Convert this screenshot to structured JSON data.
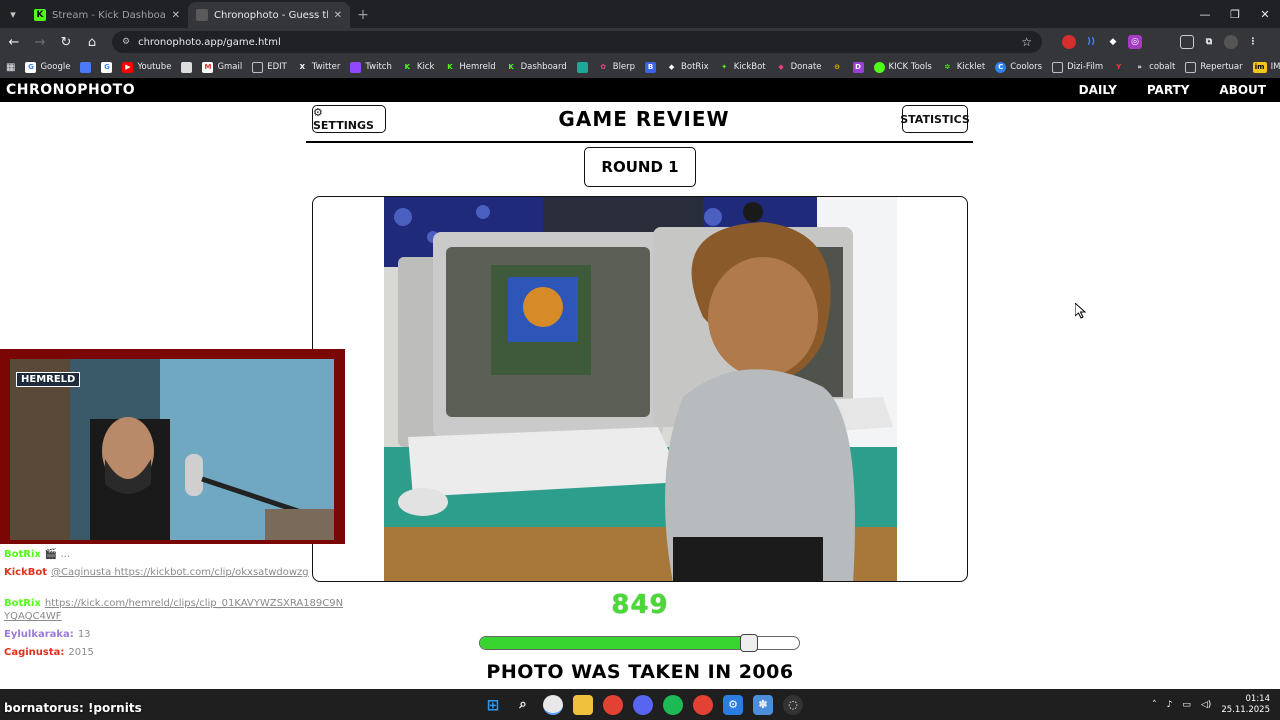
{
  "browser": {
    "tabs": [
      {
        "title": "Stream - Kick Dashboard",
        "icon": "kick-icon",
        "active": false
      },
      {
        "title": "Chronophoto - Guess the Year",
        "icon": "chronophoto-icon",
        "active": true
      }
    ],
    "url": "chronophoto.app/game.html",
    "bookmarks": [
      {
        "label": "Google",
        "icon": "google-icon"
      },
      {
        "label": "",
        "icon": "docs-icon"
      },
      {
        "label": "",
        "icon": "google-icon"
      },
      {
        "label": "Youtube",
        "icon": "youtube-icon"
      },
      {
        "label": "",
        "icon": "image-icon"
      },
      {
        "label": "Gmail",
        "icon": "gmail-icon"
      },
      {
        "label": "EDIT",
        "icon": "folder-icon"
      },
      {
        "label": "Twitter",
        "icon": "x-icon"
      },
      {
        "label": "Twitch",
        "icon": "twitch-icon"
      },
      {
        "label": "Kick",
        "icon": "kick-icon"
      },
      {
        "label": "Hemreld",
        "icon": "kick-icon"
      },
      {
        "label": "Dashboard",
        "icon": "kick-icon"
      },
      {
        "label": "",
        "icon": "chat-icon"
      },
      {
        "label": "Blerp",
        "icon": "blerp-icon"
      },
      {
        "label": "",
        "icon": "shield-icon"
      },
      {
        "label": "BotRix",
        "icon": "botrix-icon"
      },
      {
        "label": "KickBot",
        "icon": "kickbot-icon"
      },
      {
        "label": "Donate",
        "icon": "donate-icon"
      },
      {
        "label": "",
        "icon": "coin-icon"
      },
      {
        "label": "",
        "icon": "badge-icon"
      },
      {
        "label": "KICK Tools",
        "icon": "kicktools-icon"
      },
      {
        "label": "Kicklet",
        "icon": "kicklet-icon"
      },
      {
        "label": "Coolors",
        "icon": "coolors-icon"
      },
      {
        "label": "Dizi-Film",
        "icon": "folder-icon"
      },
      {
        "label": "",
        "icon": "yandex-icon"
      },
      {
        "label": "cobalt",
        "icon": "cobalt-icon"
      },
      {
        "label": "Repertuar",
        "icon": "folder-icon"
      },
      {
        "label": "IMDb",
        "icon": "imdb-icon"
      }
    ]
  },
  "site": {
    "logo": "CHRONOPHOTO",
    "nav": [
      "DAILY",
      "PARTY",
      "ABOUT"
    ]
  },
  "game": {
    "settings_label": "⚙ SETTINGS",
    "title": "GAME REVIEW",
    "statistics_label": "STATISTICS",
    "round_label": "ROUND 1",
    "score": "849",
    "slider_fraction": 0.84,
    "verdict": "PHOTO WAS TAKEN IN 2006"
  },
  "stream": {
    "cam_label": "HEMRELD",
    "chat": [
      {
        "user": "BotRix",
        "user_color": "#53fc18",
        "text": "🎬 ..."
      },
      {
        "user": "KickBot",
        "user_color": "#e0301e",
        "text": "@Caginusta https://kickbot.com/clip/okxsatwdowzg"
      },
      {
        "user": "",
        "user_color": "#53fc18",
        "text": ""
      },
      {
        "user": "BotRix",
        "user_color": "#53fc18",
        "text": "https://kick.com/hemreld/clips/clip_01KAVYWZSXRA189C9NYQAQC4WF"
      },
      {
        "user": "Eylulkaraka:",
        "user_color": "#9b7bd8",
        "text": "13"
      },
      {
        "user": "Caginusta:",
        "user_color": "#e0301e",
        "text": "2015"
      }
    ],
    "overlay_message": "bornatorus: !pornits"
  },
  "taskbar": {
    "time": "01:14",
    "date": "25.11.2025"
  },
  "colors": {
    "score_green": "#4ad936",
    "slider_green": "#38d430",
    "chrome_dark": "#202124"
  }
}
